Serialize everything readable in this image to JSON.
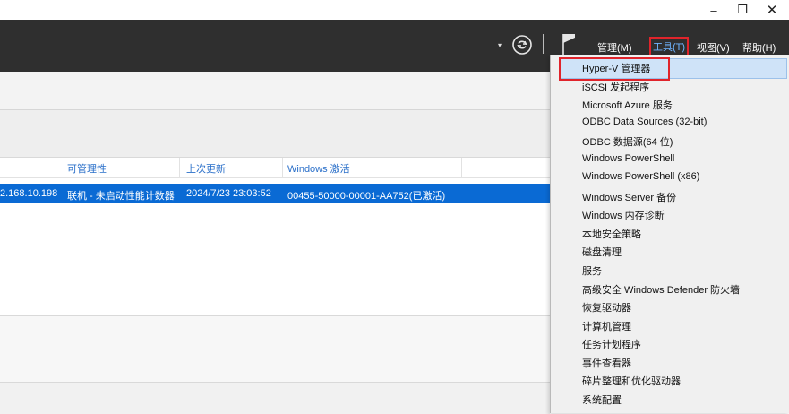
{
  "window": {
    "minimize": "–",
    "maximize": "❐",
    "close": "✕"
  },
  "menubar": {
    "manage": "管理(M)",
    "tools": "工具(T)",
    "view": "视图(V)",
    "help": "帮助(H)",
    "dropdown_arrow": "▾"
  },
  "table": {
    "columns": [
      "可管理性",
      "上次更新",
      "Windows 激活"
    ],
    "selected_row": {
      "ip": "2.168.10.198",
      "manageability": "联机 - 未启动性能计数器",
      "last_update": "2024/7/23 23:03:52",
      "activation": "00455-50000-00001-AA752(已激活)"
    }
  },
  "tools_menu": {
    "items": [
      "Hyper-V 管理器",
      "iSCSI 发起程序",
      "Microsoft Azure 服务",
      "ODBC Data Sources (32-bit)",
      "ODBC 数据源(64 位)",
      "Windows PowerShell",
      "Windows PowerShell (x86)",
      "Windows Server 备份",
      "Windows 内存诊断",
      "本地安全策略",
      "磁盘清理",
      "服务",
      "高级安全 Windows Defender 防火墙",
      "恢复驱动器",
      "计算机管理",
      "任务计划程序",
      "事件查看器",
      "碎片整理和优化驱动器",
      "系统配置"
    ]
  },
  "colors": {
    "command_bar": "#2f2f2f",
    "selection": "#0a6ad4",
    "highlight_box": "#e0242b",
    "link_blue": "#2a6fc9"
  }
}
